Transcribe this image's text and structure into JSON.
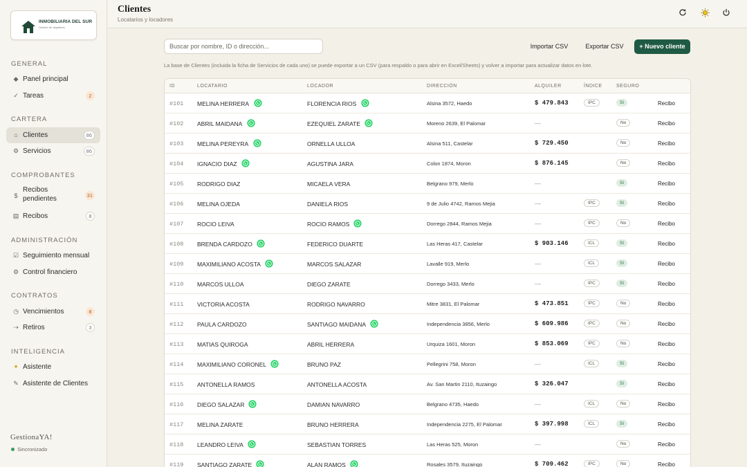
{
  "logo": {
    "title": "INMOBILIARIA DEL SUR",
    "subtitle": "Gestión de alquileres"
  },
  "sidebar": {
    "sections": [
      {
        "title": "GENERAL",
        "items": [
          {
            "label": "Panel principal",
            "icon": "diamond-icon",
            "badge": ""
          },
          {
            "label": "Tareas",
            "icon": "check-icon",
            "badge": "2",
            "badge_style": "warn"
          }
        ]
      },
      {
        "title": "CARTERA",
        "items": [
          {
            "label": "Clientes",
            "icon": "home-icon",
            "badge": "86",
            "badge_style": "muted",
            "active": true
          },
          {
            "label": "Servicios",
            "icon": "gear-icon",
            "badge": "86",
            "badge_style": "muted"
          }
        ]
      },
      {
        "title": "COMPROBANTES",
        "items": [
          {
            "label": "Recibos pendientes",
            "icon": "dollar-icon",
            "badge": "31",
            "badge_style": "warn"
          },
          {
            "label": "Recibos",
            "icon": "receipt-icon",
            "badge": "8",
            "badge_style": "muted"
          }
        ]
      },
      {
        "title": "ADMINISTRACIÓN",
        "items": [
          {
            "label": "Seguimiento mensual",
            "icon": "checkbox-icon",
            "badge": ""
          },
          {
            "label": "Control financiero",
            "icon": "gear-icon",
            "badge": ""
          }
        ]
      },
      {
        "title": "CONTRATOS",
        "items": [
          {
            "label": "Vencimientos",
            "icon": "clock-icon",
            "badge": "8",
            "badge_style": "warn"
          },
          {
            "label": "Retiros",
            "icon": "arrow-right-icon",
            "badge": "3",
            "badge_style": "muted"
          }
        ]
      },
      {
        "title": "INTELIGENCIA",
        "items": [
          {
            "label": "Asistente",
            "icon": "sparkle-icon",
            "badge": ""
          },
          {
            "label": "Asistente de Clientes",
            "icon": "chat-icon",
            "badge": ""
          }
        ]
      }
    ],
    "brand": "GestionaYA!",
    "sync_status": "Sincronizado"
  },
  "header": {
    "title": "Clientes",
    "subtitle": "Locatarios y locadores"
  },
  "toolbar": {
    "search_placeholder": "Buscar por nombre, ID o dirección...",
    "import_label": "Importar CSV",
    "export_label": "Exportar CSV",
    "new_label": "+ Nuevo cliente"
  },
  "info_text": "La base de Clientes (incluida la ficha de Servicios de cada uno) se puede exportar a un CSV (para respaldo o para abrir en Excel/Sheets) y volver a importar para actualizar datos en lote.",
  "table": {
    "columns": [
      "ID",
      "LOCATARIO",
      "LOCADOR",
      "DIRECCIÓN",
      "ALQUILER",
      "ÍNDICE",
      "SEGURO",
      ""
    ],
    "rows": [
      {
        "id": "#101",
        "locatario": "MELINA HERRERA",
        "wa_loc": true,
        "locador": "FLORENCIA RIOS",
        "wa_lcd": true,
        "direccion": "Alsina 3572, Haedo",
        "alquiler": "$ 479.843",
        "indice": "IPC",
        "seguro": "Sí",
        "recibo": "Recibo"
      },
      {
        "id": "#102",
        "locatario": "ABRIL MAIDANA",
        "wa_loc": true,
        "locador": "EZEQUIEL ZARATE",
        "wa_lcd": true,
        "direccion": "Moreno 2639, El Palomar",
        "alquiler": "—",
        "indice": "",
        "seguro": "No",
        "recibo": "Recibo"
      },
      {
        "id": "#103",
        "locatario": "MELINA PEREYRA",
        "wa_loc": true,
        "locador": "ORNELLA ULLOA",
        "wa_lcd": false,
        "direccion": "Alsina 511, Castelar",
        "alquiler": "$ 729.450",
        "indice": "",
        "seguro": "No",
        "recibo": "Recibo"
      },
      {
        "id": "#104",
        "locatario": "IGNACIO DIAZ",
        "wa_loc": true,
        "locador": "AGUSTINA JARA",
        "wa_lcd": false,
        "direccion": "Colon 1874, Moron",
        "alquiler": "$ 876.145",
        "indice": "",
        "seguro": "No",
        "recibo": "Recibo"
      },
      {
        "id": "#105",
        "locatario": "RODRIGO DIAZ",
        "wa_loc": false,
        "locador": "MICAELA VERA",
        "wa_lcd": false,
        "direccion": "Belgrano 979, Merlo",
        "alquiler": "—",
        "indice": "",
        "seguro": "Sí",
        "recibo": "Recibo"
      },
      {
        "id": "#106",
        "locatario": "MELINA OJEDA",
        "wa_loc": false,
        "locador": "DANIELA RIOS",
        "wa_lcd": false,
        "direccion": "9 de Julio 4742, Ramos Mejia",
        "alquiler": "—",
        "indice": "IPC",
        "seguro": "Sí",
        "recibo": "Recibo"
      },
      {
        "id": "#107",
        "locatario": "ROCIO LEIVA",
        "wa_loc": false,
        "locador": "ROCIO RAMOS",
        "wa_lcd": true,
        "direccion": "Dorrego 2844, Ramos Mejia",
        "alquiler": "—",
        "indice": "IPC",
        "seguro": "No",
        "recibo": "Recibo"
      },
      {
        "id": "#108",
        "locatario": "BRENDA CARDOZO",
        "wa_loc": true,
        "locador": "FEDERICO DUARTE",
        "wa_lcd": false,
        "direccion": "Las Heras 417, Castelar",
        "alquiler": "$ 903.146",
        "indice": "ICL",
        "seguro": "Sí",
        "recibo": "Recibo"
      },
      {
        "id": "#109",
        "locatario": "MAXIMILIANO ACOSTA",
        "wa_loc": true,
        "locador": "MARCOS SALAZAR",
        "wa_lcd": false,
        "direccion": "Lavalle 919, Merlo",
        "alquiler": "—",
        "indice": "ICL",
        "seguro": "Sí",
        "recibo": "Recibo"
      },
      {
        "id": "#110",
        "locatario": "MARCOS ULLOA",
        "wa_loc": false,
        "locador": "DIEGO ZARATE",
        "wa_lcd": false,
        "direccion": "Dorrego 3433, Merlo",
        "alquiler": "—",
        "indice": "IPC",
        "seguro": "Sí",
        "recibo": "Recibo"
      },
      {
        "id": "#111",
        "locatario": "VICTORIA ACOSTA",
        "wa_loc": false,
        "locador": "RODRIGO NAVARRO",
        "wa_lcd": false,
        "direccion": "Mitre 3831, El Palomar",
        "alquiler": "$ 473.851",
        "indice": "IPC",
        "seguro": "No",
        "recibo": "Recibo"
      },
      {
        "id": "#112",
        "locatario": "PAULA CARDOZO",
        "wa_loc": false,
        "locador": "SANTIAGO MAIDANA",
        "wa_lcd": true,
        "direccion": "Independencia 3856, Merlo",
        "alquiler": "$ 609.986",
        "indice": "IPC",
        "seguro": "No",
        "recibo": "Recibo"
      },
      {
        "id": "#113",
        "locatario": "MATIAS QUIROGA",
        "wa_loc": false,
        "locador": "ABRIL HERRERA",
        "wa_lcd": false,
        "direccion": "Urquiza 1601, Moron",
        "alquiler": "$ 853.069",
        "indice": "IPC",
        "seguro": "No",
        "recibo": "Recibo"
      },
      {
        "id": "#114",
        "locatario": "MAXIMILIANO CORONEL",
        "wa_loc": true,
        "locador": "BRUNO PAZ",
        "wa_lcd": false,
        "direccion": "Pellegrini 758, Moron",
        "alquiler": "—",
        "indice": "ICL",
        "seguro": "Sí",
        "recibo": "Recibo"
      },
      {
        "id": "#115",
        "locatario": "ANTONELLA RAMOS",
        "wa_loc": false,
        "locador": "ANTONELLA ACOSTA",
        "wa_lcd": false,
        "direccion": "Av. San Martin 2110, Ituzaingo",
        "alquiler": "$ 326.047",
        "indice": "",
        "seguro": "Sí",
        "recibo": "Recibo"
      },
      {
        "id": "#116",
        "locatario": "DIEGO SALAZAR",
        "wa_loc": true,
        "locador": "DAMIAN NAVARRO",
        "wa_lcd": false,
        "direccion": "Belgrano 4735, Haedo",
        "alquiler": "—",
        "indice": "ICL",
        "seguro": "No",
        "recibo": "Recibo"
      },
      {
        "id": "#117",
        "locatario": "MELINA ZARATE",
        "wa_loc": false,
        "locador": "BRUNO HERRERA",
        "wa_lcd": false,
        "direccion": "Independencia 2275, El Palomar",
        "alquiler": "$ 397.998",
        "indice": "ICL",
        "seguro": "Sí",
        "recibo": "Recibo"
      },
      {
        "id": "#118",
        "locatario": "LEANDRO LEIVA",
        "wa_loc": true,
        "locador": "SEBASTIAN TORRES",
        "wa_lcd": false,
        "direccion": "Las Heras 525, Moron",
        "alquiler": "—",
        "indice": "",
        "seguro": "No",
        "recibo": "Recibo"
      },
      {
        "id": "#119",
        "locatario": "SANTIAGO ZARATE",
        "wa_loc": true,
        "locador": "ALAN RAMOS",
        "wa_lcd": true,
        "direccion": "Rosales 3579, Ituzaingo",
        "alquiler": "$ 709.462",
        "indice": "IPC",
        "seguro": "No",
        "recibo": "Recibo"
      }
    ]
  },
  "colors": {
    "accent": "#1f5a44",
    "whatsapp": "#25d366",
    "badge_warn": "#fbe6d4",
    "seguro_si": "#dfeee2"
  }
}
